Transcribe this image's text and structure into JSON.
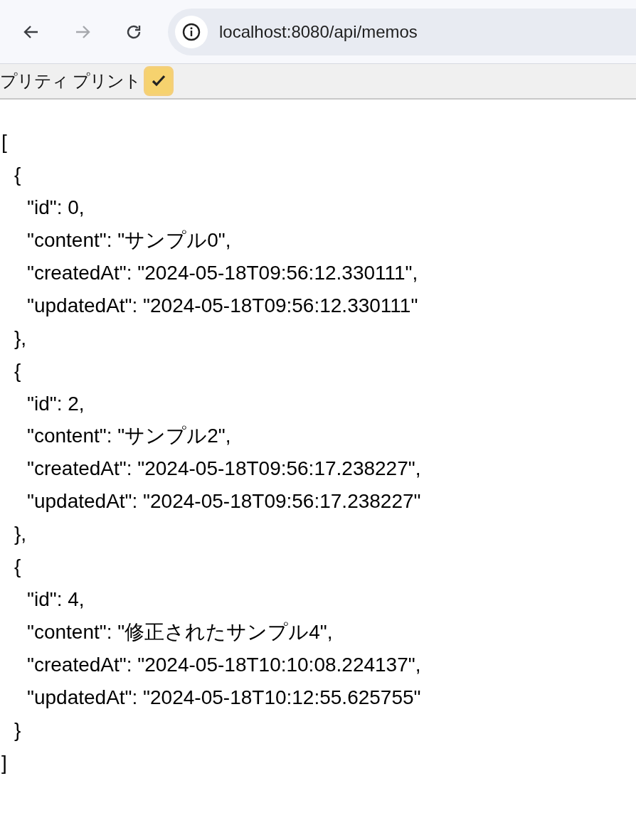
{
  "toolbar": {
    "back": {
      "disabled": false
    },
    "forward": {
      "disabled": true
    },
    "url": "localhost:8080/api/memos"
  },
  "pretty_print": {
    "label": "プリティ プリント",
    "checked": true
  },
  "json_view": {
    "open": "[",
    "close": "]",
    "objects": [
      {
        "open": "{",
        "close": "},",
        "fields": [
          "\"id\": 0,",
          "\"content\": \"サンプル0\",",
          "\"createdAt\": \"2024-05-18T09:56:12.330111\",",
          "\"updatedAt\": \"2024-05-18T09:56:12.330111\""
        ]
      },
      {
        "open": "{",
        "close": "},",
        "fields": [
          "\"id\": 2,",
          "\"content\": \"サンプル2\",",
          "\"createdAt\": \"2024-05-18T09:56:17.238227\",",
          "\"updatedAt\": \"2024-05-18T09:56:17.238227\""
        ]
      },
      {
        "open": "{",
        "close": "}",
        "fields": [
          "\"id\": 4,",
          "\"content\": \"修正されたサンプル4\",",
          "\"createdAt\": \"2024-05-18T10:10:08.224137\",",
          "\"updatedAt\": \"2024-05-18T10:12:55.625755\""
        ]
      }
    ]
  }
}
